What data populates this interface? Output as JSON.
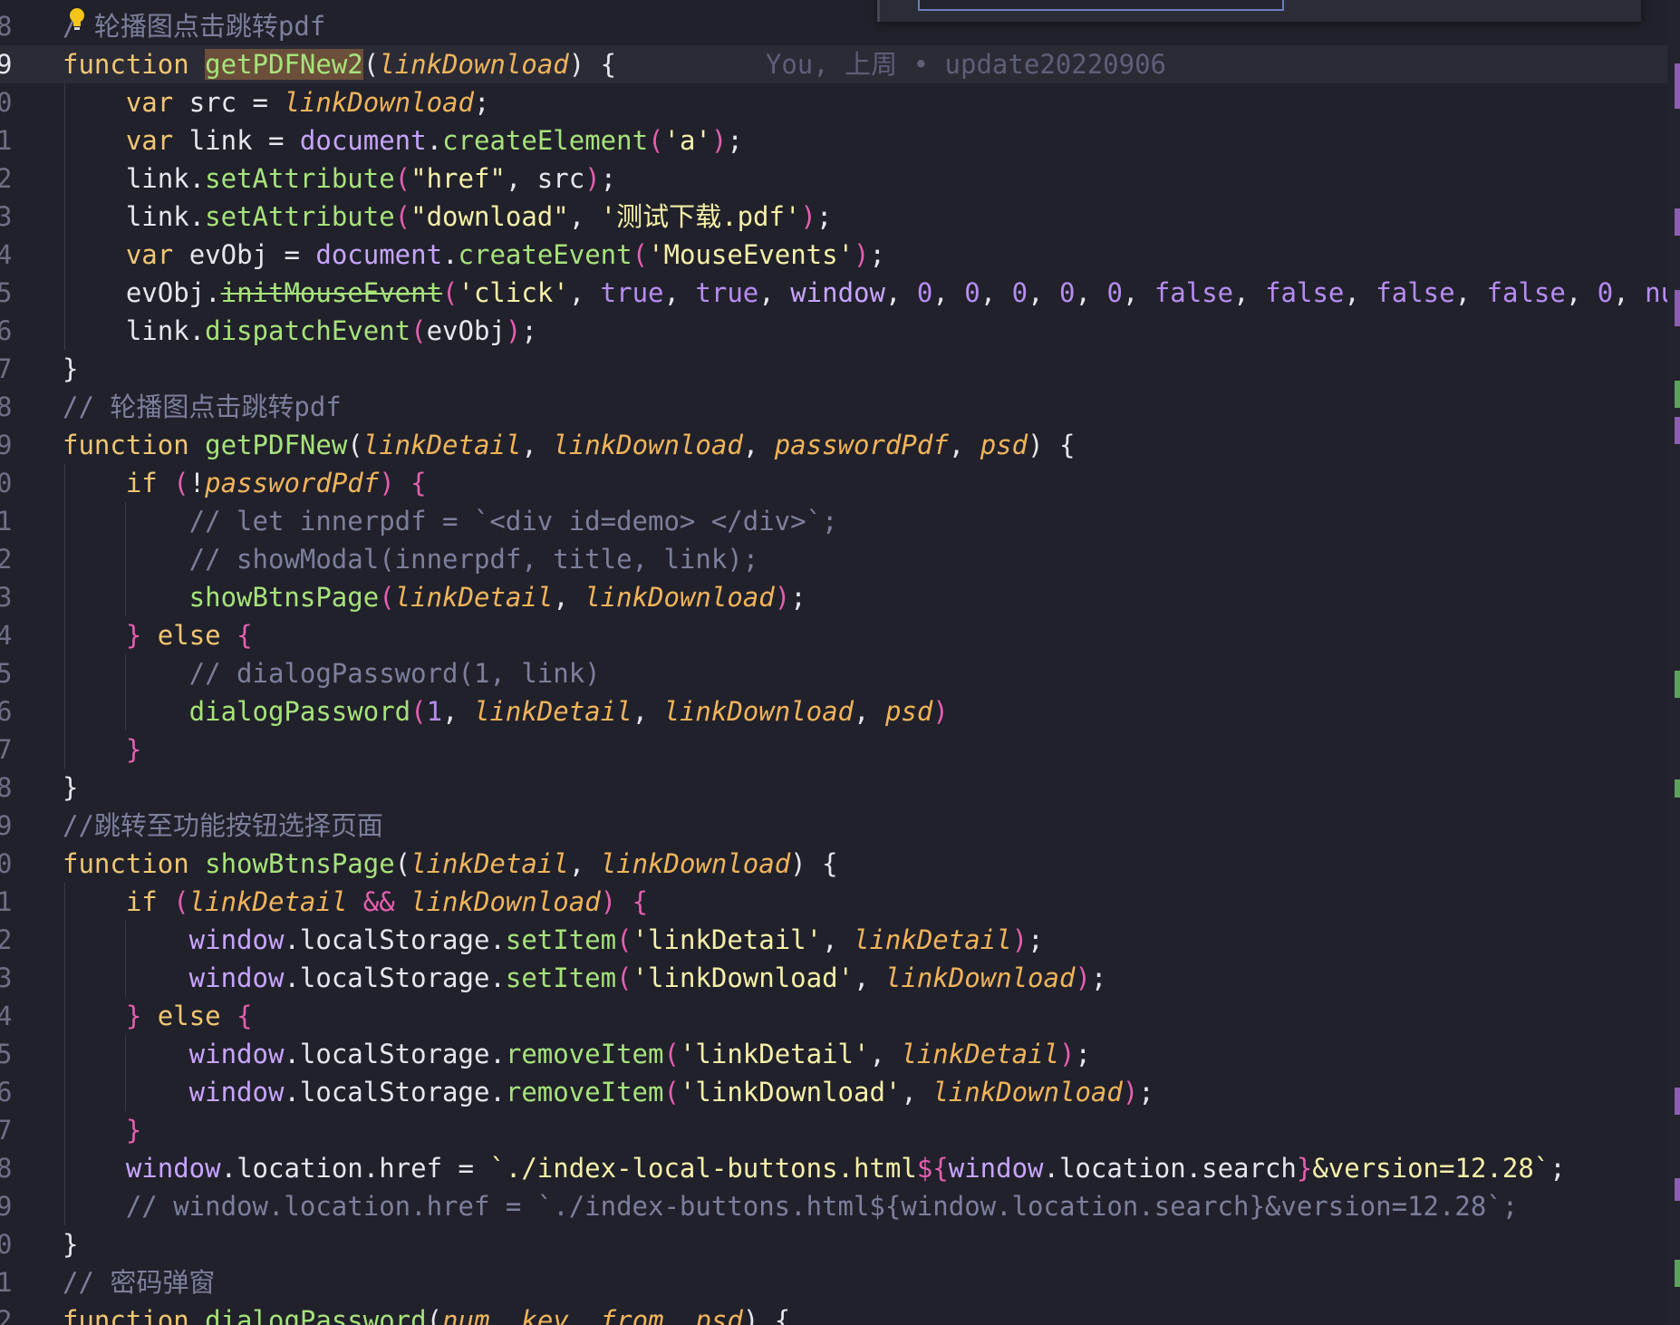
{
  "blame": "You, 上周 • update20220906",
  "line_numbers": [
    "8",
    "9",
    "0",
    "1",
    "2",
    "3",
    "4",
    "5",
    "6",
    "7",
    "8",
    "9",
    "0",
    "1",
    "2",
    "3",
    "4",
    "5",
    "6",
    "7",
    "8",
    "9",
    "0",
    "1",
    "2",
    "3",
    "4",
    "5",
    "6",
    "7",
    "8",
    "9",
    "0",
    "1",
    "2"
  ],
  "colors": {
    "background": "#21212b",
    "keyword": "#f0c674",
    "function": "#a6e37a",
    "parameter": "#f0b45a",
    "string": "#f6f0a8",
    "comment": "#7c7f9c",
    "number": "#b78cf2",
    "bracket": "#e45fb0"
  },
  "lines": [
    [
      [
        "cm",
        "/ 轮播图点击跳转pdf"
      ]
    ],
    [
      [
        "kw",
        "function "
      ],
      [
        "fnhl",
        "getPDFNew2"
      ],
      [
        "punc",
        "("
      ],
      [
        "param",
        "linkDownload"
      ],
      [
        "punc",
        ") {"
      ]
    ],
    [
      [
        "kw",
        "    var "
      ],
      [
        "punc",
        "src = "
      ],
      [
        "param",
        "linkDownload"
      ],
      [
        "punc",
        ";"
      ]
    ],
    [
      [
        "kw",
        "    var "
      ],
      [
        "punc",
        "link = "
      ],
      [
        "glob",
        "document"
      ],
      [
        "punc",
        "."
      ],
      [
        "fn",
        "createElement"
      ],
      [
        "paren",
        "("
      ],
      [
        "str",
        "'a'"
      ],
      [
        "paren",
        ")"
      ],
      [
        "punc",
        ";"
      ]
    ],
    [
      [
        "punc",
        "    link."
      ],
      [
        "fn",
        "setAttribute"
      ],
      [
        "paren",
        "("
      ],
      [
        "str",
        "\"href\""
      ],
      [
        "punc",
        ", src"
      ],
      [
        "paren",
        ")"
      ],
      [
        "punc",
        ";"
      ]
    ],
    [
      [
        "punc",
        "    link."
      ],
      [
        "fn",
        "setAttribute"
      ],
      [
        "paren",
        "("
      ],
      [
        "str",
        "\"download\""
      ],
      [
        "punc",
        ", "
      ],
      [
        "str",
        "'测试下载.pdf'"
      ],
      [
        "paren",
        ")"
      ],
      [
        "punc",
        ";"
      ]
    ],
    [
      [
        "kw",
        "    var "
      ],
      [
        "punc",
        "evObj = "
      ],
      [
        "glob",
        "document"
      ],
      [
        "punc",
        "."
      ],
      [
        "fn",
        "createEvent"
      ],
      [
        "paren",
        "("
      ],
      [
        "str",
        "'MouseEvents'"
      ],
      [
        "paren",
        ")"
      ],
      [
        "punc",
        ";"
      ]
    ],
    [
      [
        "punc",
        "    evObj."
      ],
      [
        "fn strike",
        "initMouseEvent"
      ],
      [
        "paren",
        "("
      ],
      [
        "str",
        "'click'"
      ],
      [
        "punc",
        ", "
      ],
      [
        "bool",
        "true"
      ],
      [
        "punc",
        ", "
      ],
      [
        "bool",
        "true"
      ],
      [
        "punc",
        ", "
      ],
      [
        "glob",
        "window"
      ],
      [
        "punc",
        ", "
      ],
      [
        "num",
        "0"
      ],
      [
        "punc",
        ", "
      ],
      [
        "num",
        "0"
      ],
      [
        "punc",
        ", "
      ],
      [
        "num",
        "0"
      ],
      [
        "punc",
        ", "
      ],
      [
        "num",
        "0"
      ],
      [
        "punc",
        ", "
      ],
      [
        "num",
        "0"
      ],
      [
        "punc",
        ", "
      ],
      [
        "bool",
        "false"
      ],
      [
        "punc",
        ", "
      ],
      [
        "bool",
        "false"
      ],
      [
        "punc",
        ", "
      ],
      [
        "bool",
        "false"
      ],
      [
        "punc",
        ", "
      ],
      [
        "bool",
        "false"
      ],
      [
        "punc",
        ", "
      ],
      [
        "num",
        "0"
      ],
      [
        "punc",
        ", "
      ],
      [
        "bool",
        "null"
      ],
      [
        "paren",
        ")"
      ]
    ],
    [
      [
        "punc",
        "    link."
      ],
      [
        "fn",
        "dispatchEvent"
      ],
      [
        "paren",
        "("
      ],
      [
        "punc",
        "evObj"
      ],
      [
        "paren",
        ")"
      ],
      [
        "punc",
        ";"
      ]
    ],
    [
      [
        "punc",
        "}"
      ]
    ],
    [
      [
        "cm",
        "// 轮播图点击跳转pdf"
      ]
    ],
    [
      [
        "kw",
        "function "
      ],
      [
        "fn",
        "getPDFNew"
      ],
      [
        "punc",
        "("
      ],
      [
        "param",
        "linkDetail"
      ],
      [
        "punc",
        ", "
      ],
      [
        "param",
        "linkDownload"
      ],
      [
        "punc",
        ", "
      ],
      [
        "param",
        "passwordPdf"
      ],
      [
        "punc",
        ", "
      ],
      [
        "param",
        "psd"
      ],
      [
        "punc",
        ") {"
      ]
    ],
    [
      [
        "kw",
        "    if "
      ],
      [
        "paren",
        "("
      ],
      [
        "punc",
        "!"
      ],
      [
        "param",
        "passwordPdf"
      ],
      [
        "paren",
        ")"
      ],
      [
        "brace",
        " {"
      ]
    ],
    [
      [
        "cm",
        "        // let innerpdf = `<div id=demo> </div>`;"
      ]
    ],
    [
      [
        "cm",
        "        // showModal(innerpdf, title, link);"
      ]
    ],
    [
      [
        "fn",
        "        showBtnsPage"
      ],
      [
        "paren",
        "("
      ],
      [
        "param",
        "linkDetail"
      ],
      [
        "punc",
        ", "
      ],
      [
        "param",
        "linkDownload"
      ],
      [
        "paren",
        ")"
      ],
      [
        "punc",
        ";"
      ]
    ],
    [
      [
        "brace",
        "    }"
      ],
      [
        "kw",
        " else "
      ],
      [
        "brace",
        "{"
      ]
    ],
    [
      [
        "cm",
        "        // dialogPassword(1, link)"
      ]
    ],
    [
      [
        "fn",
        "        dialogPassword"
      ],
      [
        "paren",
        "("
      ],
      [
        "num",
        "1"
      ],
      [
        "punc",
        ", "
      ],
      [
        "param",
        "linkDetail"
      ],
      [
        "punc",
        ", "
      ],
      [
        "param",
        "linkDownload"
      ],
      [
        "punc",
        ", "
      ],
      [
        "param",
        "psd"
      ],
      [
        "paren",
        ")"
      ]
    ],
    [
      [
        "brace",
        "    }"
      ]
    ],
    [
      [
        "punc",
        "}"
      ]
    ],
    [
      [
        "cm",
        "//跳转至功能按钮选择页面"
      ]
    ],
    [
      [
        "kw",
        "function "
      ],
      [
        "fn",
        "showBtnsPage"
      ],
      [
        "punc",
        "("
      ],
      [
        "param",
        "linkDetail"
      ],
      [
        "punc",
        ", "
      ],
      [
        "param",
        "linkDownload"
      ],
      [
        "punc",
        ") {"
      ]
    ],
    [
      [
        "kw",
        "    if "
      ],
      [
        "paren",
        "("
      ],
      [
        "param",
        "linkDetail"
      ],
      [
        "paren",
        " && "
      ],
      [
        "param",
        "linkDownload"
      ],
      [
        "paren",
        ")"
      ],
      [
        "brace",
        " {"
      ]
    ],
    [
      [
        "glob",
        "        window"
      ],
      [
        "punc",
        ".localStorage."
      ],
      [
        "fn",
        "setItem"
      ],
      [
        "paren",
        "("
      ],
      [
        "str",
        "'linkDetail'"
      ],
      [
        "punc",
        ", "
      ],
      [
        "param",
        "linkDetail"
      ],
      [
        "paren",
        ")"
      ],
      [
        "punc",
        ";"
      ]
    ],
    [
      [
        "glob",
        "        window"
      ],
      [
        "punc",
        ".localStorage."
      ],
      [
        "fn",
        "setItem"
      ],
      [
        "paren",
        "("
      ],
      [
        "str",
        "'linkDownload'"
      ],
      [
        "punc",
        ", "
      ],
      [
        "param",
        "linkDownload"
      ],
      [
        "paren",
        ")"
      ],
      [
        "punc",
        ";"
      ]
    ],
    [
      [
        "brace",
        "    }"
      ],
      [
        "kw",
        " else "
      ],
      [
        "brace",
        "{"
      ]
    ],
    [
      [
        "glob",
        "        window"
      ],
      [
        "punc",
        ".localStorage."
      ],
      [
        "fn",
        "removeItem"
      ],
      [
        "paren",
        "("
      ],
      [
        "str",
        "'linkDetail'"
      ],
      [
        "punc",
        ", "
      ],
      [
        "param",
        "linkDetail"
      ],
      [
        "paren",
        ")"
      ],
      [
        "punc",
        ";"
      ]
    ],
    [
      [
        "glob",
        "        window"
      ],
      [
        "punc",
        ".localStorage."
      ],
      [
        "fn",
        "removeItem"
      ],
      [
        "paren",
        "("
      ],
      [
        "str",
        "'linkDownload'"
      ],
      [
        "punc",
        ", "
      ],
      [
        "param",
        "linkDownload"
      ],
      [
        "paren",
        ")"
      ],
      [
        "punc",
        ";"
      ]
    ],
    [
      [
        "brace",
        "    }"
      ]
    ],
    [
      [
        "glob",
        "    window"
      ],
      [
        "punc",
        ".location.href = "
      ],
      [
        "str",
        "`./index-local-buttons.html"
      ],
      [
        "paren",
        "${"
      ],
      [
        "glob",
        "window"
      ],
      [
        "punc",
        ".location.search"
      ],
      [
        "paren",
        "}"
      ],
      [
        "str",
        "&version=12.28`"
      ],
      [
        "punc",
        ";"
      ]
    ],
    [
      [
        "cm",
        "    // window.location.href = `./index-buttons.html${window.location.search}&version=12.28`;"
      ]
    ],
    [
      [
        "punc",
        "}"
      ]
    ],
    [
      [
        "cm",
        "// 密码弹窗"
      ]
    ],
    [
      [
        "kw",
        "function "
      ],
      [
        "fn",
        "dialogPassword"
      ],
      [
        "punc",
        "("
      ],
      [
        "param",
        "num"
      ],
      [
        "punc",
        ", "
      ],
      [
        "param",
        "key"
      ],
      [
        "punc",
        ", "
      ],
      [
        "param",
        "from"
      ],
      [
        "punc",
        ", "
      ],
      [
        "param",
        "psd"
      ],
      [
        "punc",
        ") {"
      ]
    ]
  ]
}
